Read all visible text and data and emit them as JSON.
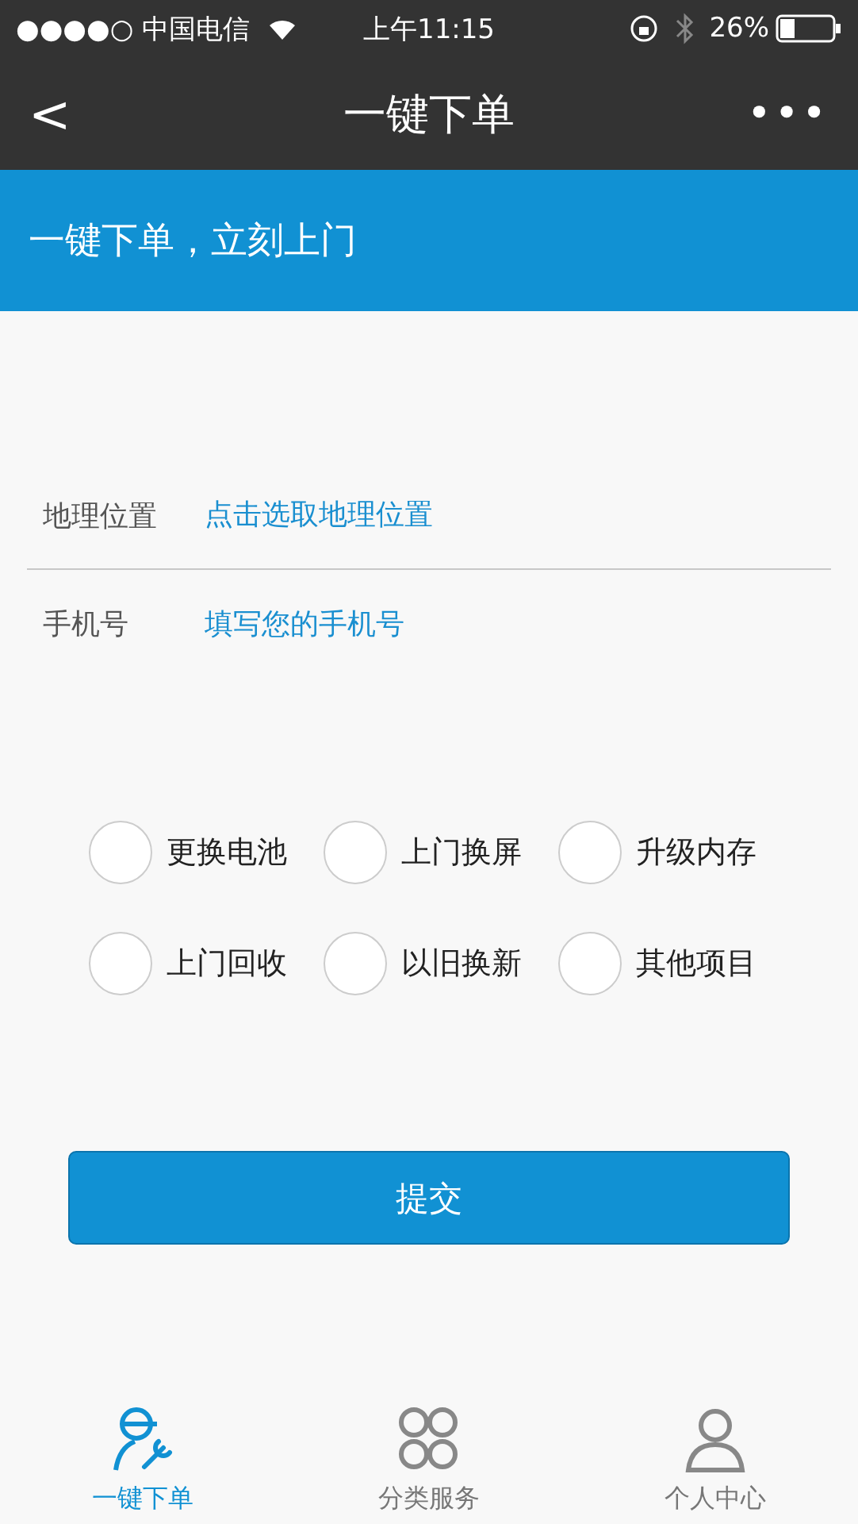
{
  "status_bar": {
    "carrier": "●●●●○ 中国电信",
    "time": "上午11:15",
    "battery": "26%"
  },
  "nav": {
    "back": "<",
    "title": "一键下单",
    "more": "•••"
  },
  "banner": {
    "text": "一键下单，立刻上门"
  },
  "fields": [
    {
      "label": "地理位置",
      "placeholder": "点击选取地理位置"
    },
    {
      "label": "手机号",
      "placeholder": "填写您的手机号"
    }
  ],
  "options": [
    {
      "label": "更换电池",
      "checked": false
    },
    {
      "label": "上门换屏",
      "checked": false
    },
    {
      "label": "升级内存",
      "checked": false
    },
    {
      "label": "上门回收",
      "checked": false
    },
    {
      "label": "以旧换新",
      "checked": false
    },
    {
      "label": "其他项目",
      "checked": false
    }
  ],
  "submit": "提交",
  "tabs": [
    {
      "label": "一键下单",
      "kind": "repair",
      "selected": true
    },
    {
      "label": "分类服务",
      "kind": "grid",
      "selected": false
    },
    {
      "label": "个人中心",
      "kind": "person",
      "selected": false
    }
  ]
}
